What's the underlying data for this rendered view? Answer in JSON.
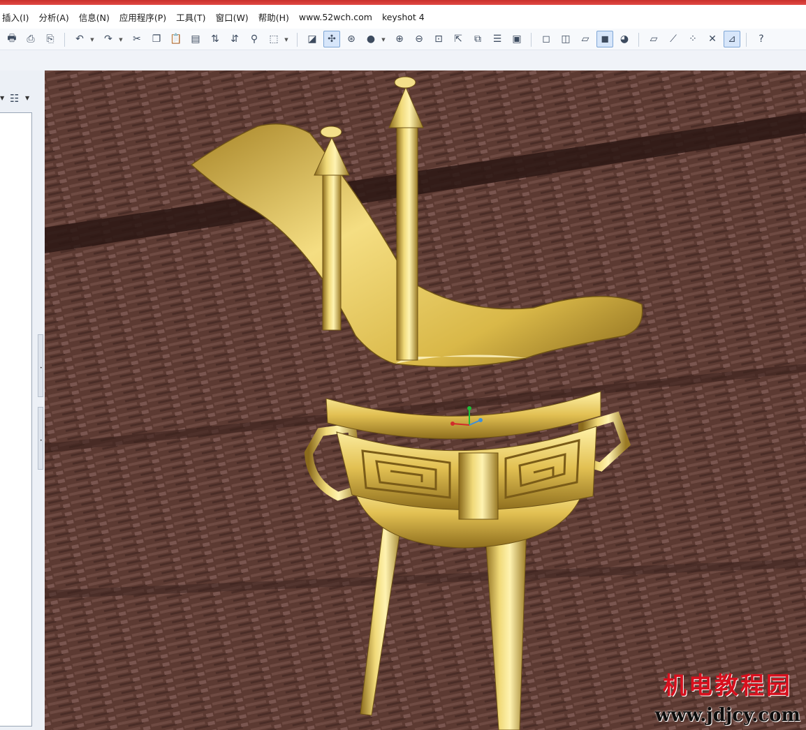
{
  "menu": [
    "插入(I)",
    "分析(A)",
    "信息(N)",
    "应用程序(P)",
    "工具(T)",
    "窗口(W)",
    "帮助(H)",
    "www.52wch.com",
    "keyshot 4"
  ],
  "toolbar_icons": [
    "print-icon",
    "print-preview-icon",
    "print-setup-icon",
    "undo-icon",
    "redo-icon",
    "cut-icon",
    "copy-icon",
    "paste-icon",
    "paste-special-icon",
    "regenerate-icon",
    "regenerate-manager-icon",
    "find-icon",
    "selection-box-icon",
    "redraw-icon",
    "spin-center-icon",
    "orient-mode-icon",
    "shading-icon",
    "zoom-in-icon",
    "zoom-out-icon",
    "refit-icon",
    "reorient-icon",
    "saved-views-icon",
    "layers-icon",
    "view-manager-icon",
    "wireframe-icon",
    "hidden-line-icon",
    "no-hidden-icon",
    "shaded-icon",
    "enhanced-realism-icon",
    "datum-planes-icon",
    "datum-axes-icon",
    "datum-points-icon",
    "coordinate-systems-icon",
    "annotations-icon",
    "whats-this-icon"
  ],
  "toolbar_active": [
    "spin-center-icon",
    "shaded-icon",
    "annotations-icon"
  ],
  "viewport": {
    "scene": "gold-bronze-jue-vessel-3d-model",
    "background": "wood-texture",
    "accent_gold": "#e8c85a",
    "wood_color": "#5a3830"
  },
  "watermark": {
    "cn": "机电教程园",
    "url": "www.jdjcy.com"
  }
}
